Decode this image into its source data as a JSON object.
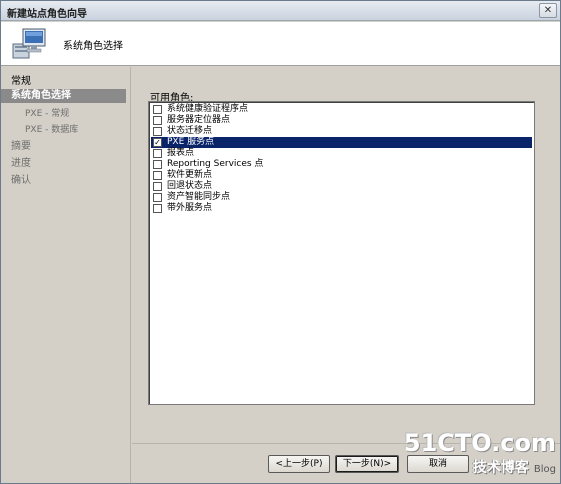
{
  "window": {
    "title": "新建站点角色向导",
    "close_glyph": "✕"
  },
  "header": {
    "title": "系统角色选择",
    "icon": "computer-wizard-icon"
  },
  "nav": {
    "items": [
      {
        "label": "常规",
        "state": "done"
      },
      {
        "label": "系统角色选择",
        "state": "selected"
      },
      {
        "label": "PXE - 常规",
        "state": "pending"
      },
      {
        "label": "PXE - 数据库",
        "state": "pending"
      },
      {
        "label": "摘要",
        "state": "pending"
      },
      {
        "label": "进度",
        "state": "pending"
      },
      {
        "label": "确认",
        "state": "pending"
      }
    ]
  },
  "roles": {
    "label": "可用角色:",
    "items": [
      {
        "label": "系统健康验证程序点",
        "checked": false,
        "selected": false
      },
      {
        "label": "服务器定位器点",
        "checked": false,
        "selected": false
      },
      {
        "label": "状态迁移点",
        "checked": false,
        "selected": false
      },
      {
        "label": "PXE 服务点",
        "checked": true,
        "selected": true
      },
      {
        "label": "报表点",
        "checked": false,
        "selected": false
      },
      {
        "label": "Reporting Services 点",
        "checked": false,
        "selected": false
      },
      {
        "label": "软件更新点",
        "checked": false,
        "selected": false
      },
      {
        "label": "回退状态点",
        "checked": false,
        "selected": false
      },
      {
        "label": "资产智能同步点",
        "checked": false,
        "selected": false
      },
      {
        "label": "带外服务点",
        "checked": false,
        "selected": false
      }
    ],
    "check_glyph": "✓"
  },
  "footer": {
    "prev_label": "<上一步(P)",
    "next_label": "下一步(N)>",
    "cancel_label": "取消"
  },
  "watermark": {
    "main": "51CTO.com",
    "sub": "技术博客",
    "blog": "Blog"
  },
  "colors": {
    "selection": "#0a246a",
    "nav_selected": "#8a8a8a",
    "dialog_bg": "#d4d0c8"
  }
}
